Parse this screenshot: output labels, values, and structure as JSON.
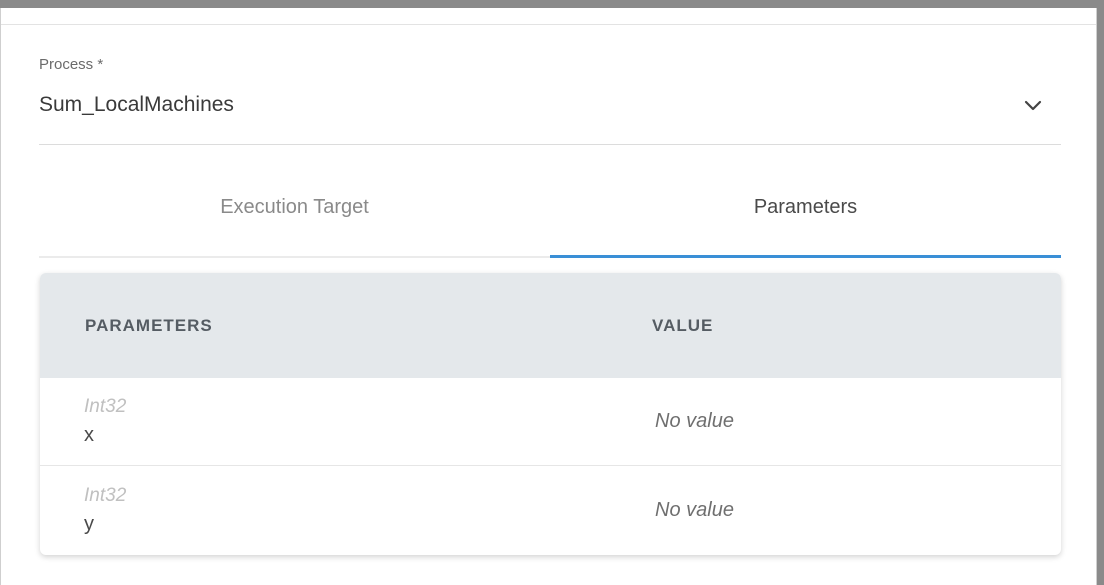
{
  "process_field": {
    "label": "Process *",
    "value": "Sum_LocalMachines"
  },
  "tabs": [
    {
      "label": "Execution Target",
      "active": false
    },
    {
      "label": "Parameters",
      "active": true
    }
  ],
  "table": {
    "headers": [
      "PARAMETERS",
      "VALUE"
    ],
    "rows": [
      {
        "type": "Int32",
        "name": "x",
        "value": "No value"
      },
      {
        "type": "Int32",
        "name": "y",
        "value": "No value"
      }
    ]
  },
  "colors": {
    "accent": "#3a8fd6",
    "table_header_bg": "#e4e8eb"
  },
  "icons": {
    "dropdown": "chevron-down-icon"
  }
}
